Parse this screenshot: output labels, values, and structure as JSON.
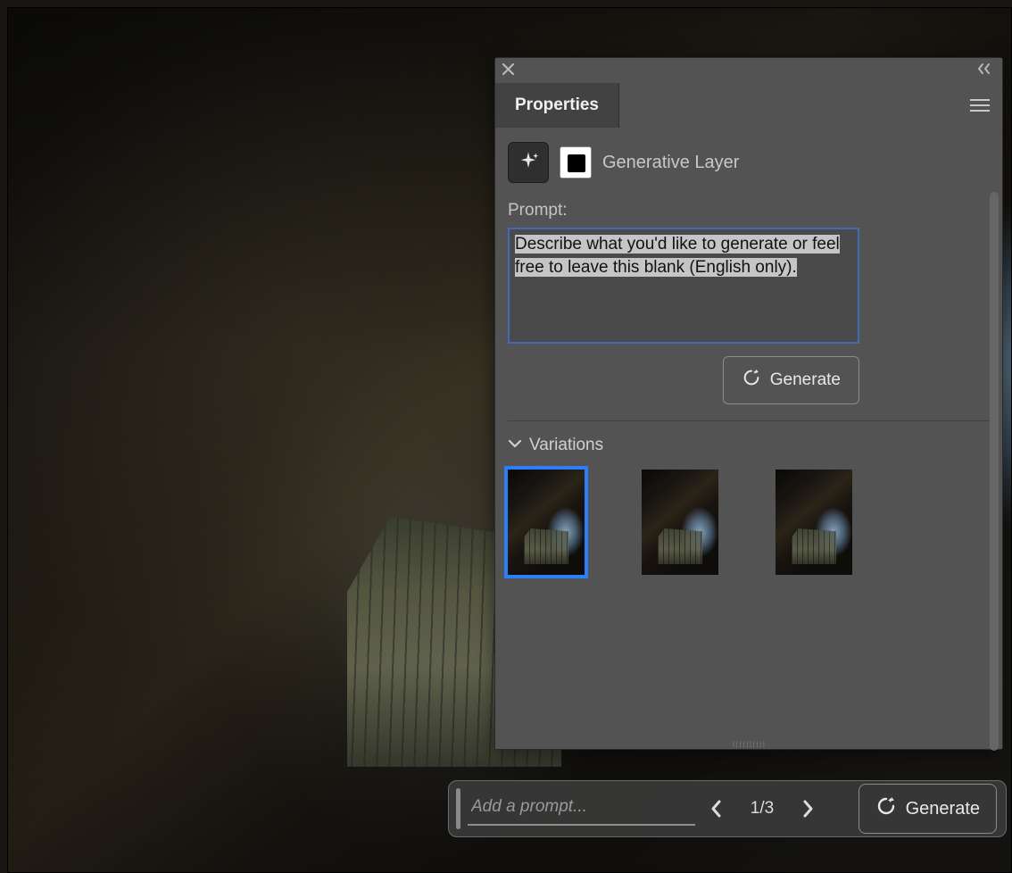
{
  "panel": {
    "tab_label": "Properties",
    "layer_title": "Generative Layer",
    "prompt_label": "Prompt:",
    "prompt_placeholder": "Describe what you'd like to generate or feel free to leave this blank (English only).",
    "generate_btn": "Generate",
    "variations_label": "Variations",
    "variation_count": 3,
    "selected_variation_index": 0
  },
  "bottombar": {
    "prompt_placeholder": "Add a prompt...",
    "nav_current": 1,
    "nav_total": 3,
    "nav_display": "1/3",
    "generate_btn": "Generate"
  }
}
